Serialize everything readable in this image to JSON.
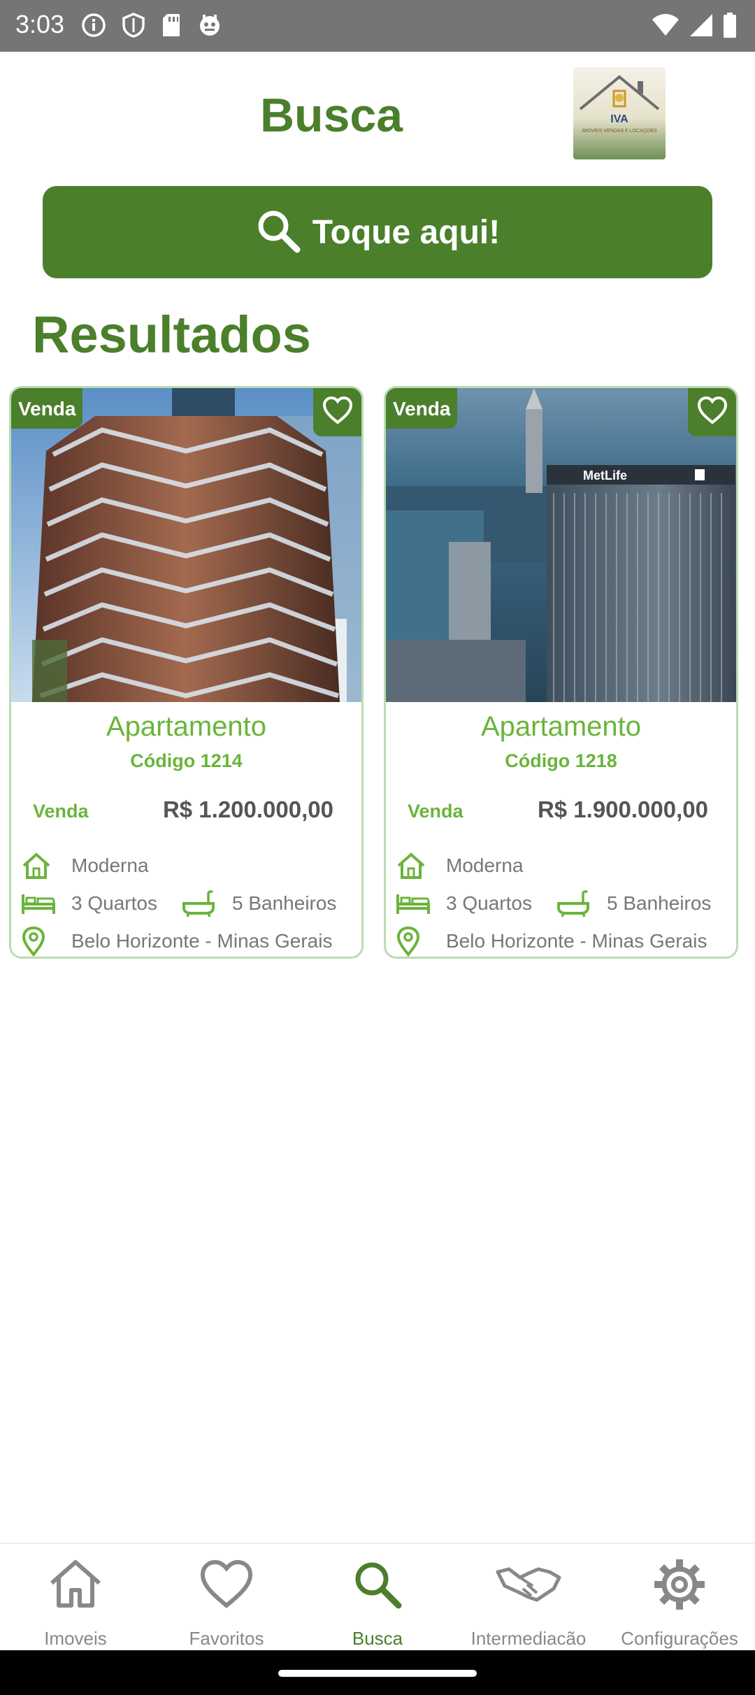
{
  "status_bar": {
    "time": "3:03",
    "icons_left": [
      "info-icon",
      "shield-icon",
      "sd-card-icon",
      "app-notification-icon"
    ],
    "icons_right": [
      "wifi-icon",
      "signal-icon",
      "battery-icon"
    ]
  },
  "header": {
    "title": "Busca",
    "logo_text": "IVA",
    "logo_subtext": "IMÓVEIS VENDAS E LOCAÇÕES"
  },
  "search_button": {
    "label": "Toque aqui!",
    "icon": "search-icon"
  },
  "results_title": "Resultados",
  "listings": [
    {
      "badge": "Venda",
      "type": "Apartamento",
      "code": "Código 1214",
      "deal": "Venda",
      "price": "R$ 1.200.000,00",
      "style": "Moderna",
      "rooms": "3 Quartos",
      "baths": "5 Banheiros",
      "location": "Belo Horizonte - Minas Gerais"
    },
    {
      "badge": "Venda",
      "type": "Apartamento",
      "code": "Código 1218",
      "deal": "Venda",
      "price": "R$ 1.900.000,00",
      "style": "Moderna",
      "rooms": "3 Quartos",
      "baths": "5 Banheiros",
      "location": "Belo Horizonte - Minas Gerais",
      "building_sign": "MetLife"
    }
  ],
  "bottom_nav": [
    {
      "label": "Imoveis",
      "icon": "home-icon",
      "active": false
    },
    {
      "label": "Favoritos",
      "icon": "heart-icon",
      "active": false
    },
    {
      "label": "Busca",
      "icon": "search-icon",
      "active": true
    },
    {
      "label": "Intermediacão",
      "icon": "handshake-icon",
      "active": false
    },
    {
      "label": "Configurações",
      "icon": "gear-icon",
      "active": false
    }
  ],
  "colors": {
    "primary": "#4b7f2b",
    "accent": "#6ab43b",
    "card_border": "#b9dcb2",
    "status_bar": "#757575"
  }
}
